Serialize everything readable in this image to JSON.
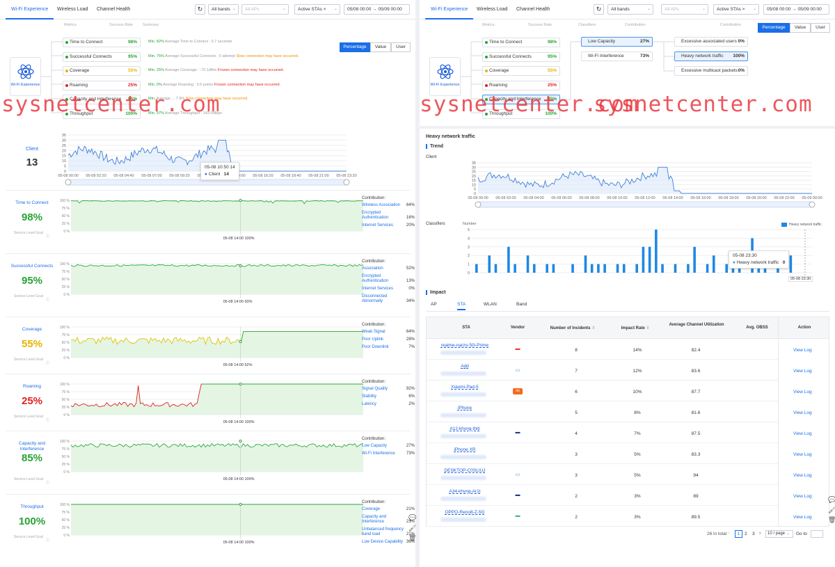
{
  "left": {
    "tabs": [
      "Wi-Fi Experience",
      "Wireless Load",
      "Channel Health"
    ],
    "bands": "All bands",
    "aps": "All APs",
    "stas": "Active STAs",
    "stas_x": "×",
    "range": "05/08 00:00 → 05/09 00:00",
    "headers": [
      "Metrics",
      "Success Rate",
      "Summary"
    ],
    "center_label": "Wi-Fi Experience",
    "seg": [
      "Percentage",
      "Value",
      "User"
    ],
    "metrics": [
      {
        "name": "Time to Connect",
        "pct": "98%",
        "color": "#27a334",
        "note_a": "Min. 82%",
        "note_b": " Average Time to Connect : 5.7 seconds",
        "note_c": ""
      },
      {
        "name": "Successful Connects",
        "pct": "95%",
        "color": "#27a334",
        "note_a": "Min. 75%",
        "note_b": " Average Successful Connects : 0 attempt ",
        "note_c": "Slow connection may have occurred."
      },
      {
        "name": "Coverage",
        "pct": "55%",
        "color": "#e8b400",
        "note_a": "Min. 25%",
        "note_b": " Average Coverage : -70.1dBm ",
        "note_c": "Frozen connection may have occurred."
      },
      {
        "name": "Roaming",
        "pct": "25%",
        "color": "#e02020",
        "note_a": "Min. 0%",
        "note_b": " Average Roaming : 3.6 points ",
        "note_c": "Frozen connection may have occurred."
      },
      {
        "name": "Capacity and Interference",
        "pct": "85%",
        "color": "#27a334",
        "note_a": "Min.",
        "note_b": " Average ... 7.9% ",
        "note_c": "Slow connection may have occurred."
      },
      {
        "name": "Throughput",
        "pct": "100%",
        "color": "#27a334",
        "note_a": "Min. 97%",
        "note_b": " Average Throughput : 143.0Mbps",
        "note_c": ""
      }
    ],
    "client": {
      "label": "Client",
      "value": "13",
      "tip_time": "05-08 10:50",
      "tip_val": "14",
      "tip_series": "Client",
      "tip_count": "14",
      "xt": [
        "05-08 00:00",
        "05-08 02:20",
        "05-08 04:40",
        "05-08 07:00",
        "05-08 09:20",
        "05-08 11:40",
        "05-08 14:00",
        "05-08 16:20",
        "05-08 18:40",
        "05-08 21:00",
        "05-08 23:20"
      ],
      "yt": [
        "35",
        "30",
        "25",
        "20",
        "15",
        "10",
        "5",
        "0"
      ]
    },
    "sections": [
      {
        "name": "Time to Connect",
        "value": "98%",
        "color": "#27a334",
        "goal": "Service Level Goal",
        "marker": "05-08 14:00 100%",
        "contr": [
          [
            "Wireless Association",
            "64%"
          ],
          [
            "Encrypted Authentication",
            "16%"
          ],
          [
            "Internet Services",
            "20%"
          ]
        ]
      },
      {
        "name": "Successful Connects",
        "value": "95%",
        "color": "#27a334",
        "goal": "Service Level Goal",
        "marker": "05-08 14:00 93%",
        "contr": [
          [
            "Association",
            "52%"
          ],
          [
            "Encrypted Authentication",
            "13%"
          ],
          [
            "Internet Services",
            "0%"
          ],
          [
            "Disconnected Abnormally",
            "34%"
          ]
        ]
      },
      {
        "name": "Coverage",
        "value": "55%",
        "color": "#e8b400",
        "goal": "Service Level Goal",
        "marker": "05-08 14:00 52%",
        "contr": [
          [
            "Weak Signal",
            "64%"
          ],
          [
            "Poor Uplink",
            "28%"
          ],
          [
            "Poor Downlink",
            "7%"
          ]
        ]
      },
      {
        "name": "Roaming",
        "value": "25%",
        "color": "#e02020",
        "goal": "Service Level Goal",
        "marker": "05-08 14:00 100%",
        "contr": [
          [
            "Signal Quality",
            "92%"
          ],
          [
            "Stability",
            "6%"
          ],
          [
            "Latency",
            "2%"
          ]
        ]
      },
      {
        "name": "Capacity and Interference",
        "value": "85%",
        "color": "#27a334",
        "goal": "Service Level Goal",
        "marker": "05-08 14:00 100%",
        "contr": [
          [
            "Low Capacity",
            "27%"
          ],
          [
            "Wi-Fi Interference",
            "73%"
          ]
        ]
      },
      {
        "name": "Throughput",
        "value": "100%",
        "color": "#27a334",
        "goal": "Service Level Goal",
        "marker": "05-08 14:00 100%",
        "contr": [
          [
            "Coverage",
            "21%"
          ],
          [
            "Capacity and Interference",
            "21%"
          ],
          [
            "Unbalanced frequency band load",
            "21%"
          ],
          [
            "Low Device Capability",
            "36%"
          ]
        ]
      }
    ],
    "pct_ticks": [
      "100 %",
      "75 %",
      "50 %",
      "25 %",
      "0 %"
    ],
    "contr_title": "Contribution:",
    "watermark": "sysnetcenter.com"
  },
  "right": {
    "headers": [
      "Metrics",
      "Success Rate",
      "Classifiers",
      "Contribution",
      "Contribution"
    ],
    "classifiers": [
      [
        "Low Capacity",
        "27%"
      ],
      [
        "Wi-Fi Interference",
        "73%"
      ]
    ],
    "contribs": [
      [
        "Excessive associated users",
        "0%"
      ],
      [
        "Heavy network traffic",
        "100%"
      ],
      [
        "Excessive multicast packets",
        "0%"
      ]
    ],
    "panel_title": "Heavy network traffic",
    "trend": "Trend",
    "client": "Client",
    "classifiers_lbl": "Classifiers",
    "number": "Number",
    "legend": "Heavy network traffic",
    "xt": [
      "05-08 00:00",
      "05-08 02:00",
      "05-08 04:00",
      "05-08 06:00",
      "05-08 08:00",
      "05-08 10:00",
      "05-08 12:00",
      "05-08 14:00",
      "05-08 16:00",
      "05-08 18:00",
      "05-08 20:00",
      "05-08 22:00",
      "05-09 00:00"
    ],
    "yt": [
      "35",
      "30",
      "25",
      "20",
      "15",
      "10",
      "5",
      "0"
    ],
    "cyt": [
      "5",
      "4",
      "3",
      "2",
      "1",
      "0"
    ],
    "tip_time": "05-08 23:30",
    "tip_series": "Heavy network traffic",
    "tip_val": "0",
    "cursor_lbl": "05-08 23:30",
    "impact": "Impact",
    "tabs": [
      "AP",
      "STA",
      "WLAN",
      "Band"
    ],
    "cols": [
      "STA",
      "Vendor",
      "Number of Incidents",
      "Impact Rate",
      "Average Channel Utilization",
      "Avg. OBSS",
      "Action"
    ],
    "rows": [
      {
        "sta": "realme-narzo-50i-Prime",
        "vendor": "realme",
        "inc": "8",
        "rate": "14%",
        "util": "82.4",
        "action": "View Log"
      },
      {
        "sta": "Add",
        "vendor": "device",
        "inc": "7",
        "rate": "12%",
        "util": "83.6",
        "action": "View Log"
      },
      {
        "sta": "Xiaomi-Pad-5",
        "vendor": "mi",
        "inc": "6",
        "rate": "10%",
        "util": "87.7",
        "action": "View Log"
      },
      {
        "sta": "iPhone",
        "vendor": "apple",
        "inc": "5",
        "rate": "8%",
        "util": "81.6",
        "action": "View Log"
      },
      {
        "sta": "A12-khvng-thiti",
        "vendor": "samsung",
        "inc": "4",
        "rate": "7%",
        "util": "87.5",
        "action": "View Log"
      },
      {
        "sta": "iPhone XR",
        "vendor": "apple",
        "inc": "3",
        "rate": "5%",
        "util": "83.3",
        "action": "View Log"
      },
      {
        "sta": "DESKTOP-C0SLIUJ",
        "vendor": "device",
        "inc": "3",
        "rate": "5%",
        "util": "94",
        "action": "View Log"
      },
      {
        "sta": "A34-khvng-Ar1t",
        "vendor": "samsung",
        "inc": "2",
        "rate": "3%",
        "util": "89",
        "action": "View Log"
      },
      {
        "sta": "OPPO-Reno8-Z-5G",
        "vendor": "oppo",
        "inc": "2",
        "rate": "3%",
        "util": "89.5",
        "action": "View Log"
      }
    ],
    "pager": {
      "total": "26 in total",
      "pages": [
        "1",
        "2",
        "3"
      ],
      "per": "10 / page",
      "goto": "Go to"
    }
  },
  "chart_data": [
    {
      "type": "line",
      "title": "",
      "ylabel": "Client",
      "ylim": [
        0,
        35
      ],
      "x": [
        "05-08 00:00",
        "05-08 02:20",
        "05-08 04:40",
        "05-08 07:00",
        "05-08 09:20",
        "05-08 11:40",
        "05-08 14:00",
        "05-08 16:20",
        "05-08 18:40",
        "05-08 21:00",
        "05-08 23:20"
      ],
      "series": [
        {
          "name": "Client",
          "values": [
            14,
            12,
            13,
            11,
            15,
            16,
            14,
            12,
            3,
            0,
            0
          ]
        }
      ]
    },
    {
      "type": "bar",
      "ylabel": "Number",
      "ylim": [
        0,
        5
      ],
      "series": [
        {
          "name": "Heavy network traffic",
          "values": [
            1,
            0,
            2,
            1,
            0,
            3,
            1,
            0,
            2,
            1,
            0,
            1,
            1,
            0,
            0,
            1,
            0,
            2,
            1,
            1,
            1,
            0,
            1,
            1,
            0,
            1,
            3,
            3,
            5,
            1,
            0,
            1,
            0,
            1,
            3,
            0,
            1,
            2,
            0,
            1,
            1,
            1,
            0,
            4,
            2,
            1,
            0,
            1,
            0,
            2,
            0
          ]
        }
      ]
    }
  ]
}
